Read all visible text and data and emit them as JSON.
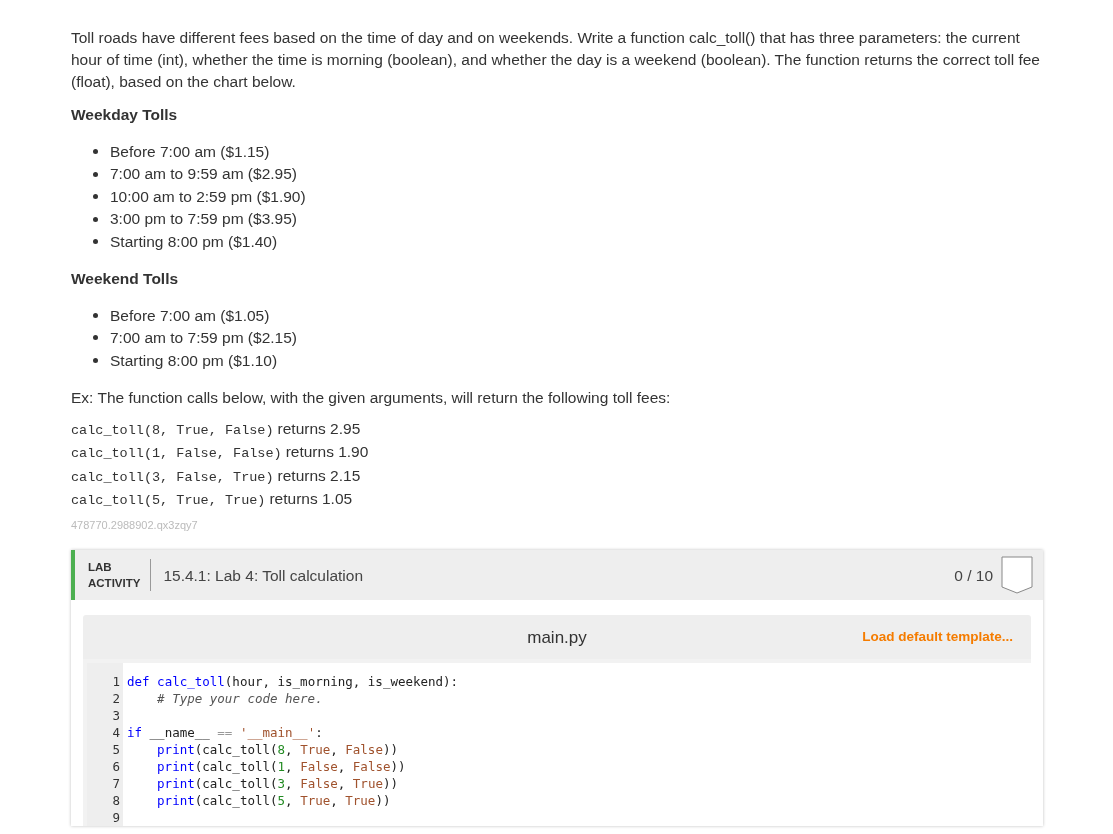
{
  "intro": "Toll roads have different fees based on the time of day and on weekends. Write a function calc_toll() that has three parameters: the current hour of time (int), whether the time is morning (boolean), and whether the day is a weekend (boolean). The function returns the correct toll fee (float), based on the chart below.",
  "sections": [
    {
      "heading": "Weekday Tolls",
      "items": [
        "Before 7:00 am ($1.15)",
        "7:00 am to 9:59 am ($2.95)",
        "10:00 am to 2:59 pm ($1.90)",
        "3:00 pm to 7:59 pm ($3.95)",
        "Starting 8:00 pm ($1.40)"
      ]
    },
    {
      "heading": "Weekend Tolls",
      "items": [
        "Before 7:00 am ($1.05)",
        "7:00 am to 7:59 pm ($2.15)",
        "Starting 8:00 pm ($1.10)"
      ]
    }
  ],
  "example_intro": "Ex: The function calls below, with the given arguments, will return the following toll fees:",
  "examples": [
    {
      "call": "calc_toll(8, True, False)",
      "result": "returns 2.95"
    },
    {
      "call": "calc_toll(1, False, False)",
      "result": "returns 1.90"
    },
    {
      "call": "calc_toll(3, False, True)",
      "result": "returns 2.15"
    },
    {
      "call": "calc_toll(5, True, True)",
      "result": "returns 1.05"
    }
  ],
  "id_text": "478770.2988902.qx3zqy7",
  "lab": {
    "label_line_1": "LAB",
    "label_line_2": "ACTIVITY",
    "title": "15.4.1: Lab 4: Toll calculation",
    "score": "0 / 10",
    "editor": {
      "filename": "main.py",
      "template_link": "Load default template...",
      "lines": [
        {
          "number": "1",
          "tokens": [
            {
              "kind": "keyword",
              "text": "def "
            },
            {
              "kind": "def",
              "text": "calc_toll"
            },
            {
              "kind": "plain",
              "text": "(hour, is_morning, is_weekend):"
            }
          ]
        },
        {
          "number": "2",
          "indent": true,
          "tokens": [
            {
              "kind": "comment",
              "text": "# Type your code here."
            }
          ]
        },
        {
          "number": "3"
        },
        {
          "number": "4",
          "tokens": [
            {
              "kind": "keyword",
              "text": "if"
            },
            {
              "kind": "plain",
              "text": " __name__ "
            },
            {
              "kind": "operator",
              "text": "== "
            },
            {
              "kind": "string",
              "text": "'__main__'"
            },
            {
              "kind": "plain",
              "text": ":"
            }
          ]
        },
        {
          "number": "5",
          "indent": true,
          "tokens": [
            {
              "kind": "builtin",
              "text": "print"
            },
            {
              "kind": "plain",
              "text": "(calc_toll("
            },
            {
              "kind": "number",
              "text": "8"
            },
            {
              "kind": "plain",
              "text": ", "
            },
            {
              "kind": "constant",
              "text": "True"
            },
            {
              "kind": "plain",
              "text": ", "
            },
            {
              "kind": "constant",
              "text": "False"
            },
            {
              "kind": "plain",
              "text": "))"
            }
          ]
        },
        {
          "number": "6",
          "indent": true,
          "tokens": [
            {
              "kind": "builtin",
              "text": "print"
            },
            {
              "kind": "plain",
              "text": "(calc_toll("
            },
            {
              "kind": "number",
              "text": "1"
            },
            {
              "kind": "plain",
              "text": ", "
            },
            {
              "kind": "constant",
              "text": "False"
            },
            {
              "kind": "plain",
              "text": ", "
            },
            {
              "kind": "constant",
              "text": "False"
            },
            {
              "kind": "plain",
              "text": "))"
            }
          ]
        },
        {
          "number": "7",
          "indent": true,
          "tokens": [
            {
              "kind": "builtin",
              "text": "print"
            },
            {
              "kind": "plain",
              "text": "(calc_toll("
            },
            {
              "kind": "number",
              "text": "3"
            },
            {
              "kind": "plain",
              "text": ", "
            },
            {
              "kind": "constant",
              "text": "False"
            },
            {
              "kind": "plain",
              "text": ", "
            },
            {
              "kind": "constant",
              "text": "True"
            },
            {
              "kind": "plain",
              "text": "))"
            }
          ]
        },
        {
          "number": "8",
          "indent": true,
          "tokens": [
            {
              "kind": "builtin",
              "text": "print"
            },
            {
              "kind": "plain",
              "text": "(calc_toll("
            },
            {
              "kind": "number",
              "text": "5"
            },
            {
              "kind": "plain",
              "text": ", "
            },
            {
              "kind": "constant",
              "text": "True"
            },
            {
              "kind": "plain",
              "text": ", "
            },
            {
              "kind": "constant",
              "text": "True"
            },
            {
              "kind": "plain",
              "text": "))"
            }
          ]
        },
        {
          "number": "9"
        }
      ]
    }
  }
}
